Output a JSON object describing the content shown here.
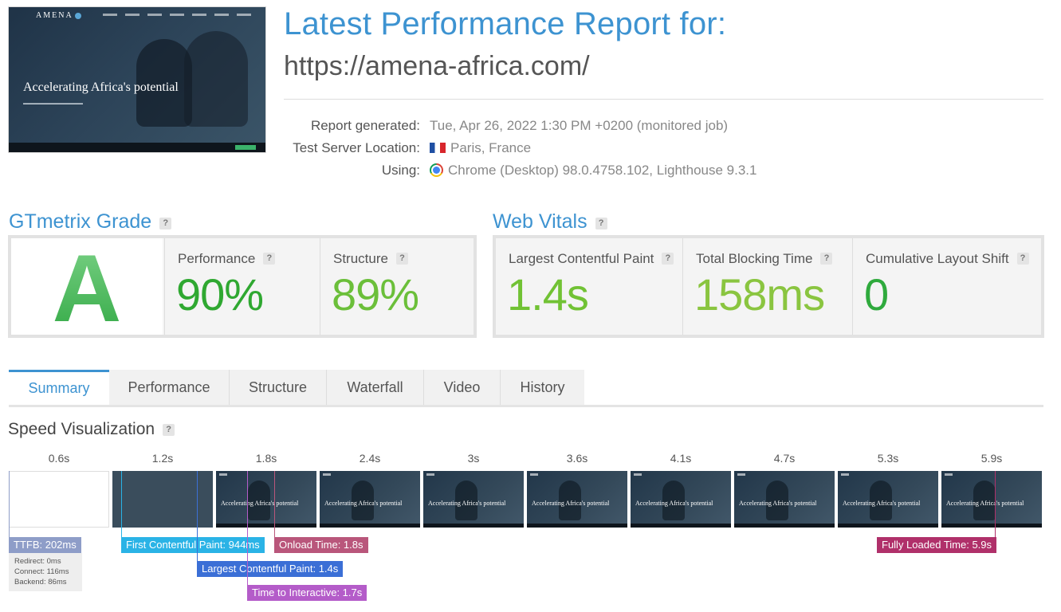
{
  "report": {
    "title": "Latest Performance Report for:",
    "url": "https://amena-africa.com/",
    "thumbnail": {
      "brand": "AMENA",
      "headline": "Accelerating Africa's potential"
    },
    "meta": [
      {
        "label": "Report generated:",
        "value": "Tue, Apr 26, 2022 1:30 PM +0200 (monitored job)",
        "icon": null
      },
      {
        "label": "Test Server Location:",
        "value": "Paris, France",
        "icon": "france-flag-icon"
      },
      {
        "label": "Using:",
        "value": "Chrome (Desktop) 98.0.4758.102, Lighthouse 9.3.1",
        "icon": "chrome-icon"
      }
    ]
  },
  "grade": {
    "title": "GTmetrix Grade",
    "letter": "A",
    "performance_label": "Performance",
    "performance_value": "90%",
    "structure_label": "Structure",
    "structure_value": "89%"
  },
  "vitals": {
    "title": "Web Vitals",
    "lcp_label": "Largest Contentful Paint",
    "lcp_value": "1.4s",
    "tbt_label": "Total Blocking Time",
    "tbt_value": "158ms",
    "cls_label": "Cumulative Layout Shift",
    "cls_value": "0"
  },
  "tabs": [
    "Summary",
    "Performance",
    "Structure",
    "Waterfall",
    "Video",
    "History"
  ],
  "active_tab": "Summary",
  "speed": {
    "title": "Speed Visualization",
    "frames": [
      {
        "time": "0.6s",
        "state": "blank"
      },
      {
        "time": "1.2s",
        "state": "plain"
      },
      {
        "time": "1.8s",
        "state": "site"
      },
      {
        "time": "2.4s",
        "state": "site"
      },
      {
        "time": "3s",
        "state": "site"
      },
      {
        "time": "3.6s",
        "state": "site"
      },
      {
        "time": "4.1s",
        "state": "site"
      },
      {
        "time": "4.7s",
        "state": "site"
      },
      {
        "time": "5.3s",
        "state": "site"
      },
      {
        "time": "5.9s",
        "state": "site"
      }
    ],
    "frame_caption": "Accelerating Africa's potential",
    "markers": {
      "ttfb": "TTFB: 202ms",
      "fcp": "First Contentful Paint: 944ms",
      "lcp": "Largest Contentful Paint: 1.4s",
      "tti": "Time to Interactive: 1.7s",
      "onload": "Onload Time: 1.8s",
      "fully_loaded": "Fully Loaded Time: 5.9s"
    },
    "ttfb_breakdown": [
      "Redirect: 0ms",
      "Connect: 116ms",
      "Backend: 86ms"
    ]
  },
  "colors": {
    "accent": "#3d93d1",
    "grade_green": "#3db14a",
    "perf_green": "#2fa831",
    "structure_green": "#6bbf3a",
    "lcp_green": "#71c234",
    "tbt_green": "#8ac540",
    "cls_green": "#2faa3d",
    "ttfb": "#8e9dc8",
    "fcp": "#2ab3e6",
    "lcp_marker": "#3b6fd6",
    "tti": "#b45cc9",
    "onload": "#b9567b",
    "fully_loaded": "#b0306a"
  }
}
